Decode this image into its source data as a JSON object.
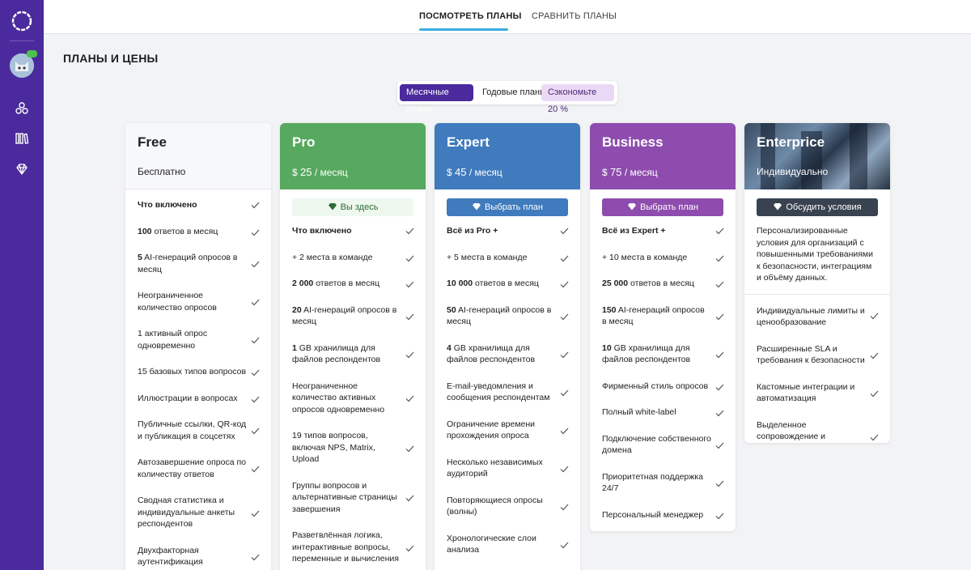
{
  "sidebar": {
    "icons": [
      "logo-ring-icon",
      "avatar",
      "hierarchy-icon",
      "library-icon",
      "diamond-icon"
    ]
  },
  "tabs": [
    {
      "label": "ПОСМОТРЕТЬ ПЛАНЫ",
      "active": true
    },
    {
      "label": "СРАВНИТЬ ПЛАНЫ",
      "active": false
    }
  ],
  "page_title": "ПЛАНЫ И ЦЕНЫ",
  "billing_toggle": {
    "monthly": "Месячные планы",
    "yearly": "Годовые планы",
    "save": "Сэкономьте 20 %"
  },
  "plans": {
    "free": {
      "name": "Free",
      "price": "Бесплатно",
      "features": [
        {
          "bold": "",
          "text": "Что включено"
        },
        {
          "bold": "100",
          "text": " ответов в месяц"
        },
        {
          "bold": "5",
          "text": " AI-генераций опросов в месяц"
        },
        {
          "bold": "",
          "text": "Неограниченное количество опросов"
        },
        {
          "bold": "",
          "text": "1 активный опрос одновременно"
        },
        {
          "bold": "",
          "text": "15 базовых типов вопросов"
        },
        {
          "bold": "",
          "text": "Иллюстрации в вопросах"
        },
        {
          "bold": "",
          "text": "Публичные ссылки, QR-код и публикация в соцсетях"
        },
        {
          "bold": "",
          "text": "Автозавершение опроса по количеству ответов"
        },
        {
          "bold": "",
          "text": "Сводная статистика и индивидуальные анкеты респондентов"
        },
        {
          "bold": "",
          "text": "Двухфакторная аутентификация"
        }
      ]
    },
    "pro": {
      "name": "Pro",
      "currency": "$",
      "amount": "25",
      "period": "/ месяц",
      "cta": "Вы здесь",
      "features": [
        {
          "bold": "Что включено",
          "text": ""
        },
        {
          "bold": "",
          "text": "+ 2 места в команде"
        },
        {
          "bold": "2 000",
          "text": " ответов в месяц"
        },
        {
          "bold": "20",
          "text": " AI-генераций опросов в месяц"
        },
        {
          "bold": "1",
          "text": " GB хранилища для файлов респондентов"
        },
        {
          "bold": "",
          "text": "Неограниченное количество активных опросов одновременно"
        },
        {
          "bold": "",
          "text": "19 типов вопросов, включая NPS, Matrix, Upload"
        },
        {
          "bold": "",
          "text": "Группы вопросов и альтернативные страницы завершения"
        },
        {
          "bold": "",
          "text": "Разветвлённая логика, интерактивные вопросы, переменные и вычисления"
        }
      ]
    },
    "expert": {
      "name": "Expert",
      "currency": "$",
      "amount": "45",
      "period": "/ месяц",
      "cta": "Выбрать план",
      "features": [
        {
          "bold": "Всё из Pro +",
          "text": ""
        },
        {
          "bold": "",
          "text": "+ 5 места в команде"
        },
        {
          "bold": "10 000",
          "text": " ответов в месяц"
        },
        {
          "bold": "50",
          "text": " AI-генераций опросов в месяц"
        },
        {
          "bold": "4",
          "text": " GB хранилища для файлов респондентов"
        },
        {
          "bold": "",
          "text": "E-mail-уведомления и сообщения респондентам"
        },
        {
          "bold": "",
          "text": "Ограничение времени прохождения опроса"
        },
        {
          "bold": "",
          "text": "Несколько независимых аудиторий"
        },
        {
          "bold": "",
          "text": "Повторяющиеся опросы (волны)"
        },
        {
          "bold": "",
          "text": "Хронологические слои анализа"
        }
      ]
    },
    "business": {
      "name": "Business",
      "currency": "$",
      "amount": "75",
      "period": "/ месяц",
      "cta": "Выбрать план",
      "features": [
        {
          "bold": "Всё из Expert +",
          "text": ""
        },
        {
          "bold": "",
          "text": "+ 10 места в команде"
        },
        {
          "bold": "25 000",
          "text": " ответов в месяц"
        },
        {
          "bold": "150",
          "text": " AI-генераций опросов в месяц"
        },
        {
          "bold": "10",
          "text": " GB хранилища для файлов респондентов"
        },
        {
          "bold": "",
          "text": "Фирменный стиль опросов"
        },
        {
          "bold": "",
          "text": "Полный white-label"
        },
        {
          "bold": "",
          "text": "Подключение собственного домена"
        },
        {
          "bold": "",
          "text": "Приоритетная поддержка 24/7"
        },
        {
          "bold": "",
          "text": "Персональный менеджер"
        }
      ]
    },
    "enterprise": {
      "name": "Enterprice",
      "price": "Индивидуально",
      "cta": "Обсудить условия",
      "description": "Персонализированные условия для организаций с повышенными требованиями к безопасности, интеграциям и объёму данных.",
      "features": [
        {
          "bold": "",
          "text": "Индивидуальные лимиты и ценообразование"
        },
        {
          "bold": "",
          "text": "Расширенные SLA и требования к безопасности"
        },
        {
          "bold": "",
          "text": "Кастомные интеграции и автоматизация"
        },
        {
          "bold": "",
          "text": "Выделенное сопровождение и онбординг"
        }
      ]
    }
  },
  "colors": {
    "sidebar": "#4a2a9c",
    "pro": "#56a95e",
    "expert": "#3f7bbd",
    "business": "#8e4cae",
    "enterprise_cta": "#39424f",
    "tab_underline": "#3aaee0"
  }
}
